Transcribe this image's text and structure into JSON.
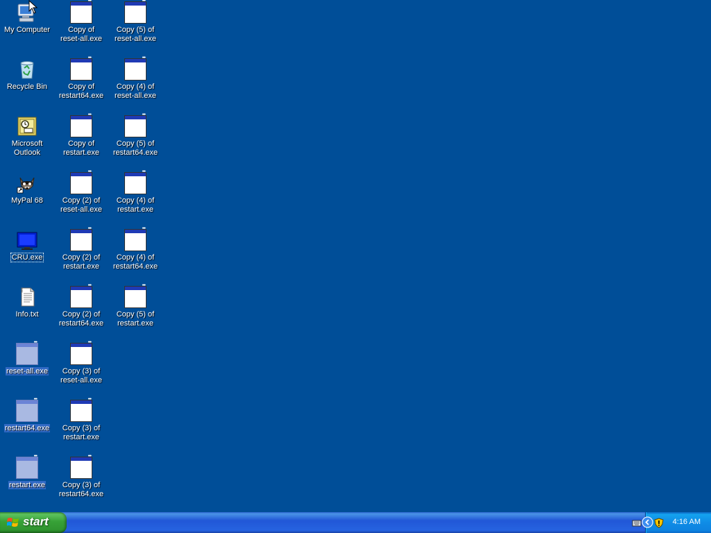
{
  "desktop": {
    "icons": {
      "my_computer": "My Computer",
      "recycle_bin": "Recycle Bin",
      "outlook_1": "Microsoft",
      "outlook_2": "Outlook",
      "mypal": "MyPal 68",
      "cru": "CRU.exe",
      "info": "Info.txt",
      "reset_all": "reset-all.exe",
      "restart64": "restart64.exe",
      "restart": "restart.exe",
      "c1_reset_all_1": "Copy of",
      "c1_reset_all_2": "reset-all.exe",
      "c1_restart64_1": "Copy of",
      "c1_restart64_2": "restart64.exe",
      "c1_restart_1": "Copy of",
      "c1_restart_2": "restart.exe",
      "c2_reset_all_1": "Copy (2) of",
      "c2_reset_all_2": "reset-all.exe",
      "c2_restart_1": "Copy (2) of",
      "c2_restart_2": "restart.exe",
      "c2_restart64_1": "Copy (2) of",
      "c2_restart64_2": "restart64.exe",
      "c3_reset_all_1": "Copy (3) of",
      "c3_reset_all_2": "reset-all.exe",
      "c3_restart_1": "Copy (3) of",
      "c3_restart_2": "restart.exe",
      "c3_restart64_1": "Copy (3) of",
      "c3_restart64_2": "restart64.exe",
      "c5_reset_all_1": "Copy (5) of",
      "c5_reset_all_2": "reset-all.exe",
      "c4_reset_all_1": "Copy (4) of",
      "c4_reset_all_2": "reset-all.exe",
      "c5_restart64_1": "Copy (5) of",
      "c5_restart64_2": "restart64.exe",
      "c4_restart_1": "Copy (4) of",
      "c4_restart_2": "restart.exe",
      "c4_restart64_1": "Copy (4) of",
      "c4_restart64_2": "restart64.exe",
      "c5_restart_1": "Copy (5) of",
      "c5_restart_2": "restart.exe"
    }
  },
  "taskbar": {
    "start_label": "start",
    "clock": "4:16 AM"
  },
  "colors": {
    "desktop_background": "#004e98",
    "selection": "#316ac5",
    "start_button": "#37a137",
    "taskbar": "#2157d7"
  }
}
